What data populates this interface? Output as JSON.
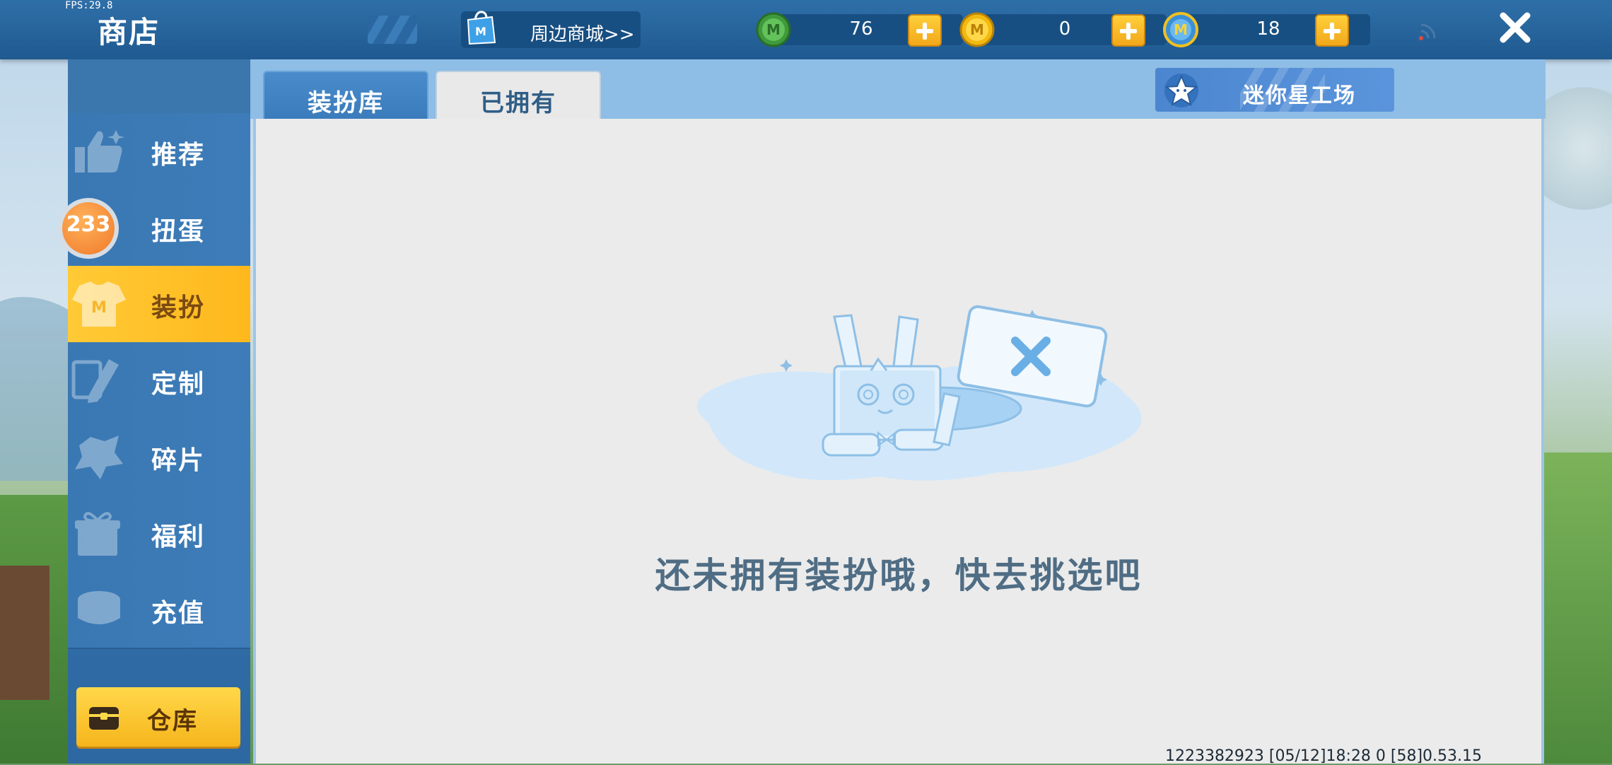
{
  "status": {
    "fps": "FPS:29.8"
  },
  "header": {
    "title": "商店",
    "mall_link": "周边商城>>",
    "currencies": [
      {
        "icon": "green-m-coin-icon",
        "value": "76",
        "color": "#4caf50"
      },
      {
        "icon": "gold-m-coin-icon",
        "value": "0",
        "color": "#f2b90f"
      },
      {
        "icon": "blue-m-coin-icon",
        "value": "18",
        "color": "#4aa3e0"
      }
    ]
  },
  "sidebar": {
    "items": [
      {
        "label": "推荐",
        "icon": "thumbs-up-icon"
      },
      {
        "label": "扭蛋",
        "icon": "gacha-icon",
        "badge": "233"
      },
      {
        "label": "装扮",
        "icon": "costume-icon"
      },
      {
        "label": "定制",
        "icon": "pencil-icon"
      },
      {
        "label": "碎片",
        "icon": "fragment-icon"
      },
      {
        "label": "福利",
        "icon": "gift-icon"
      },
      {
        "label": "充值",
        "icon": "coins-icon"
      }
    ],
    "active_index": 2,
    "warehouse_label": "仓库"
  },
  "tabs": [
    {
      "label": "装扮库",
      "selected": false
    },
    {
      "label": "已拥有",
      "selected": true
    }
  ],
  "star_workshop_label": "迷你星工场",
  "main": {
    "empty_message": "还未拥有装扮哦，快去挑选吧",
    "footer_info": "1223382923  [05/12]18:28 0  [58]0.53.15"
  },
  "colors": {
    "accent": "#ffc22a",
    "header": "#2364a0",
    "panel": "#ebebeb"
  }
}
